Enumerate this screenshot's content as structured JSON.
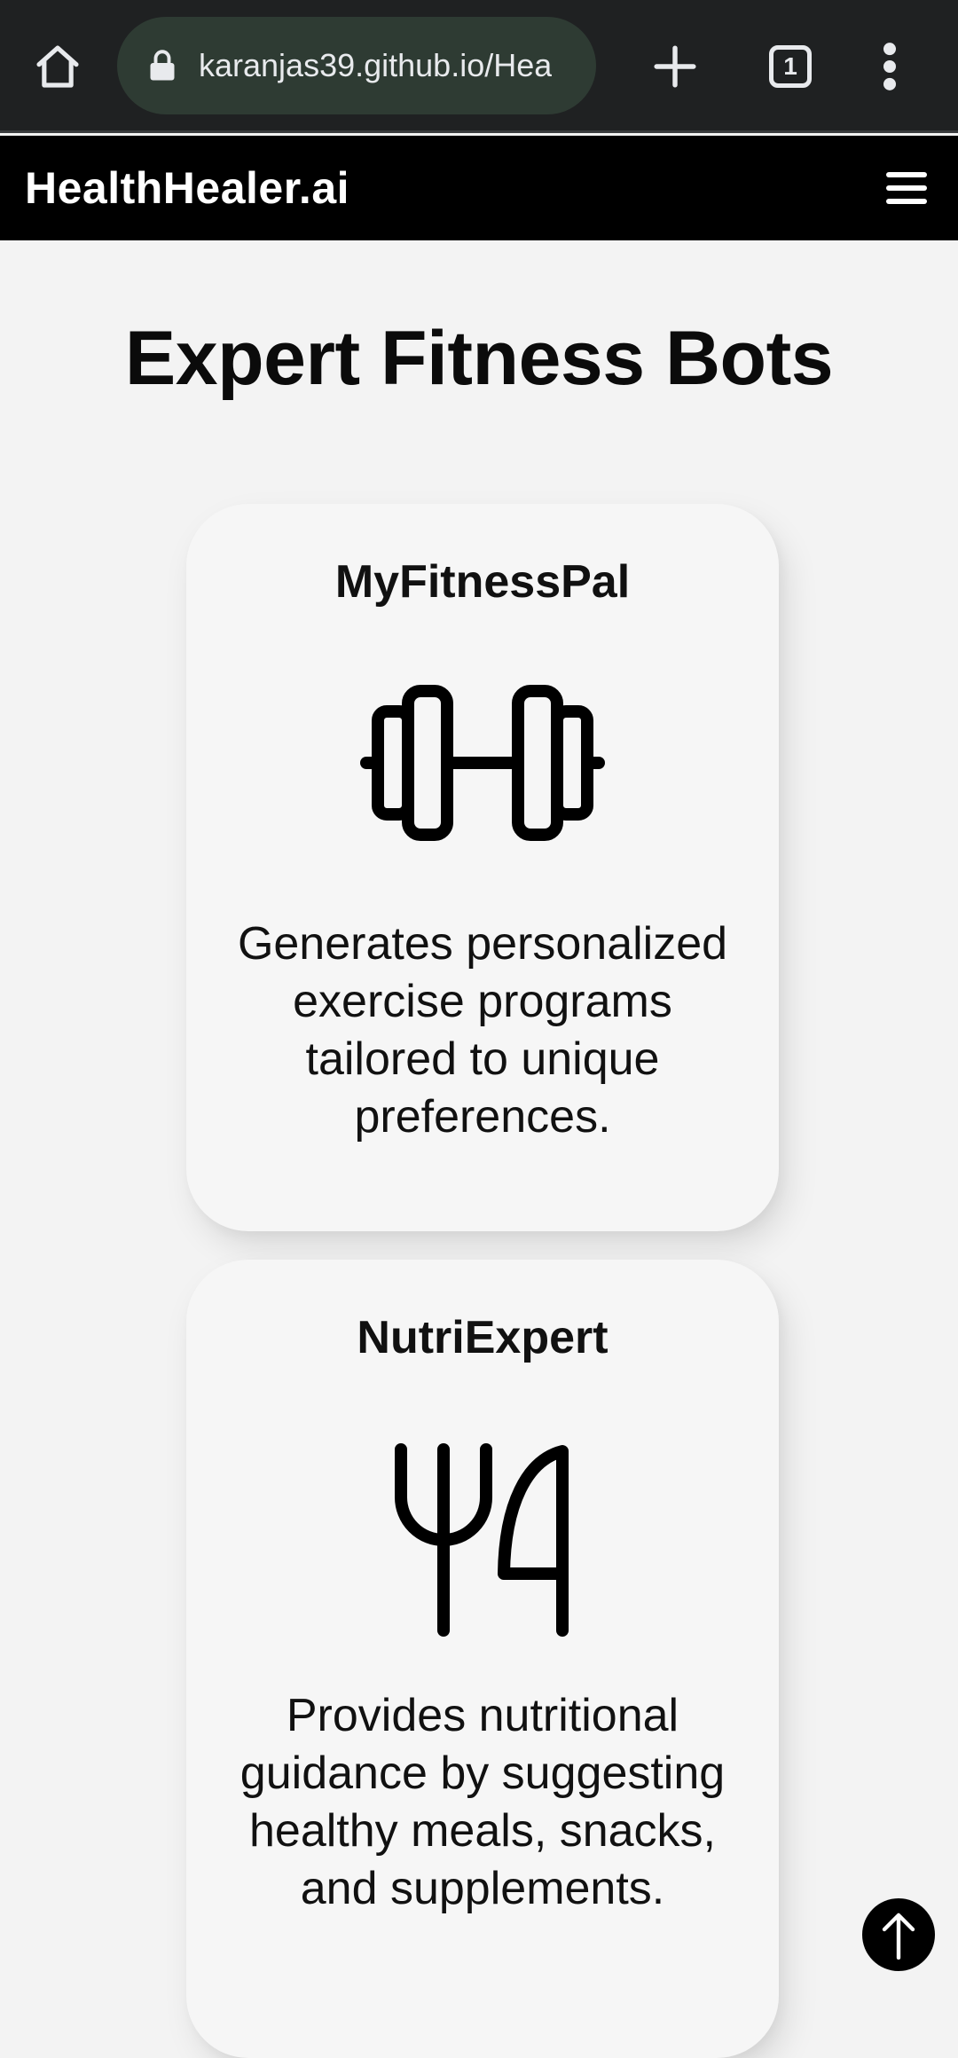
{
  "browser": {
    "url": "karanjas39.github.io/Hea",
    "tab_count": "1"
  },
  "header": {
    "logo": "HealthHealer.ai"
  },
  "main": {
    "title": "Expert Fitness Bots",
    "cards": [
      {
        "title": "MyFitnessPal",
        "icon": "dumbbell-icon",
        "description": "Generates personalized exercise programs tailored to unique preferences."
      },
      {
        "title": "NutriExpert",
        "icon": "fork-knife-icon",
        "description": "Provides nutritional guidance by suggesting healthy meals, snacks, and supplements."
      }
    ]
  },
  "colors": {
    "header_bg": "#000000",
    "page_bg": "#f3f3f3",
    "card_bg": "#f6f6f6",
    "browser_bg": "#1f2122"
  }
}
